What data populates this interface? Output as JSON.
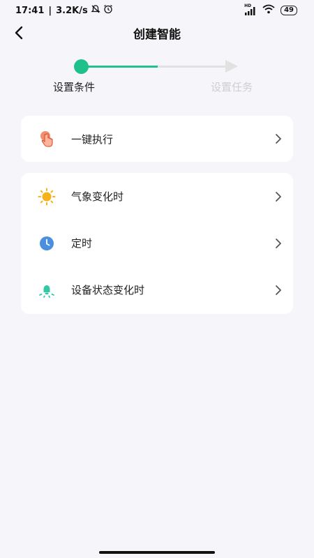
{
  "status_bar": {
    "time": "17:41",
    "separator": "|",
    "net_speed": "3.2K/s",
    "network_label": "HD",
    "battery": "49"
  },
  "header": {
    "title": "创建智能"
  },
  "stepper": {
    "steps": [
      {
        "label": "设置条件",
        "active": true
      },
      {
        "label": "设置任务",
        "active": false
      }
    ]
  },
  "conditions": {
    "group1": [
      {
        "label": "一键执行",
        "icon": "tap-hand-icon"
      }
    ],
    "group2": [
      {
        "label": "气象变化时",
        "icon": "sun-icon"
      },
      {
        "label": "定时",
        "icon": "clock-icon"
      },
      {
        "label": "设备状态变化时",
        "icon": "device-bulb-icon"
      }
    ]
  },
  "colors": {
    "accent": "#1fc08a",
    "inactive": "#e1e1e1",
    "background": "#f6f5f9",
    "sun": "#f6b21b",
    "clock": "#4a8fe0",
    "hand": "#f07a55"
  }
}
